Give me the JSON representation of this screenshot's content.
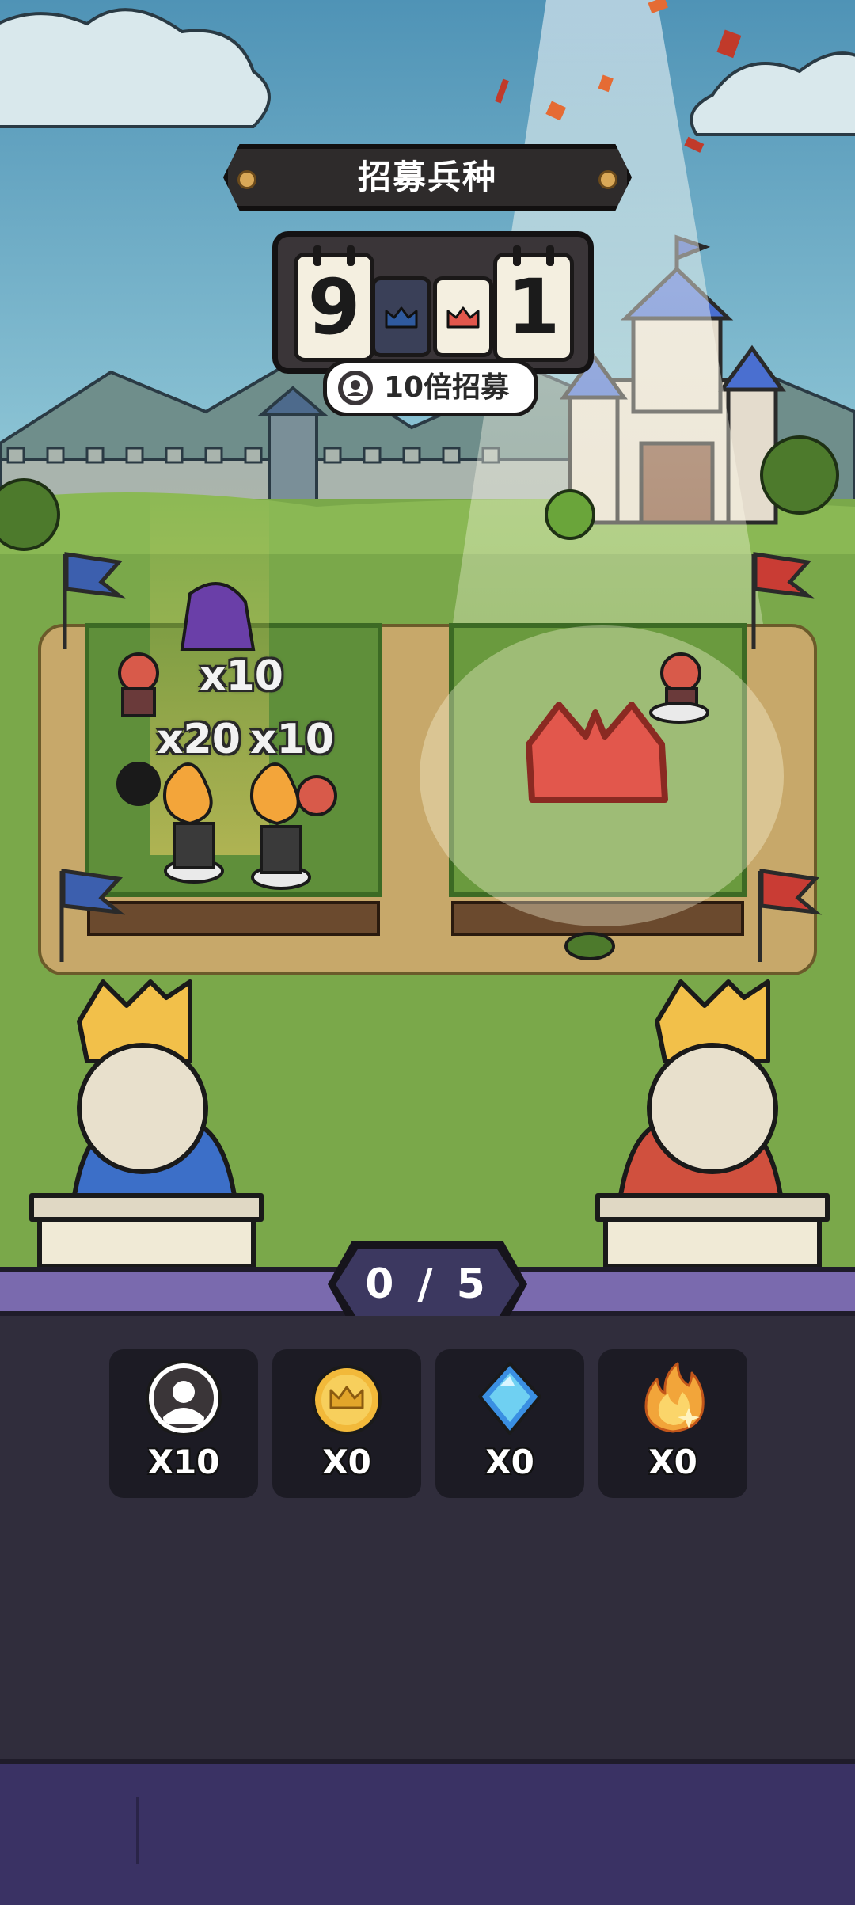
{
  "title": "招募兵种",
  "score": {
    "left": "9",
    "right": "1"
  },
  "multiplier_button": "10倍招募",
  "floating_multipliers": [
    "x10",
    "x20",
    "x10"
  ],
  "progress": "0 / 5",
  "resources": [
    {
      "icon": "recruit-token-icon",
      "count": "X10"
    },
    {
      "icon": "gold-crown-coin-icon",
      "count": "X0"
    },
    {
      "icon": "blue-gem-icon",
      "count": "X0"
    },
    {
      "icon": "fire-icon",
      "count": "X0"
    }
  ],
  "colors": {
    "blue_team": "#3c5fae",
    "red_team": "#e2574c",
    "purple_bar": "#7a6aae",
    "panel": "#302d3c",
    "tile": "#1c1b24"
  }
}
